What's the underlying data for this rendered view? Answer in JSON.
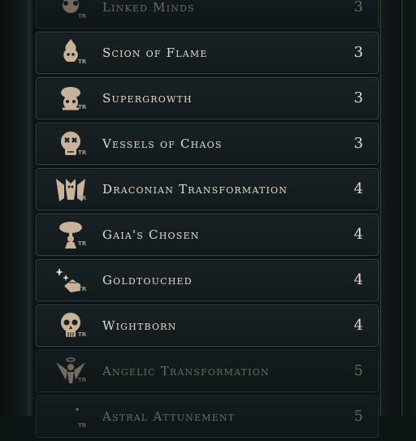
{
  "traits": [
    {
      "name": "Linked Minds",
      "tier": "3",
      "badge": "TR",
      "icon": "linked-minds-icon",
      "dim": true
    },
    {
      "name": "Scion of Flame",
      "tier": "3",
      "badge": "TR",
      "icon": "flame-head-icon",
      "dim": false
    },
    {
      "name": "Supergrowth",
      "tier": "3",
      "badge": "TR",
      "icon": "sprouting-head-icon",
      "dim": false
    },
    {
      "name": "Vessels of Chaos",
      "tier": "3",
      "badge": "TR",
      "icon": "chaos-skull-icon",
      "dim": false
    },
    {
      "name": "Draconian Transformation",
      "tier": "4",
      "badge": "TR",
      "icon": "dragon-icon",
      "dim": false
    },
    {
      "name": "Gaia's Chosen",
      "tier": "4",
      "badge": "TR",
      "icon": "tree-figure-icon",
      "dim": false
    },
    {
      "name": "Goldtouched",
      "tier": "4",
      "badge": "TR",
      "icon": "sparkle-hand-icon",
      "dim": false
    },
    {
      "name": "Wightborn",
      "tier": "4",
      "badge": "TR",
      "icon": "skull-icon",
      "dim": false
    },
    {
      "name": "Angelic Transformation",
      "tier": "5",
      "badge": "TR",
      "icon": "winged-halo-icon",
      "dim": true
    },
    {
      "name": "Astral Attunement",
      "tier": "5",
      "badge": "TR",
      "icon": "moon-star-icon",
      "dim": true
    }
  ]
}
